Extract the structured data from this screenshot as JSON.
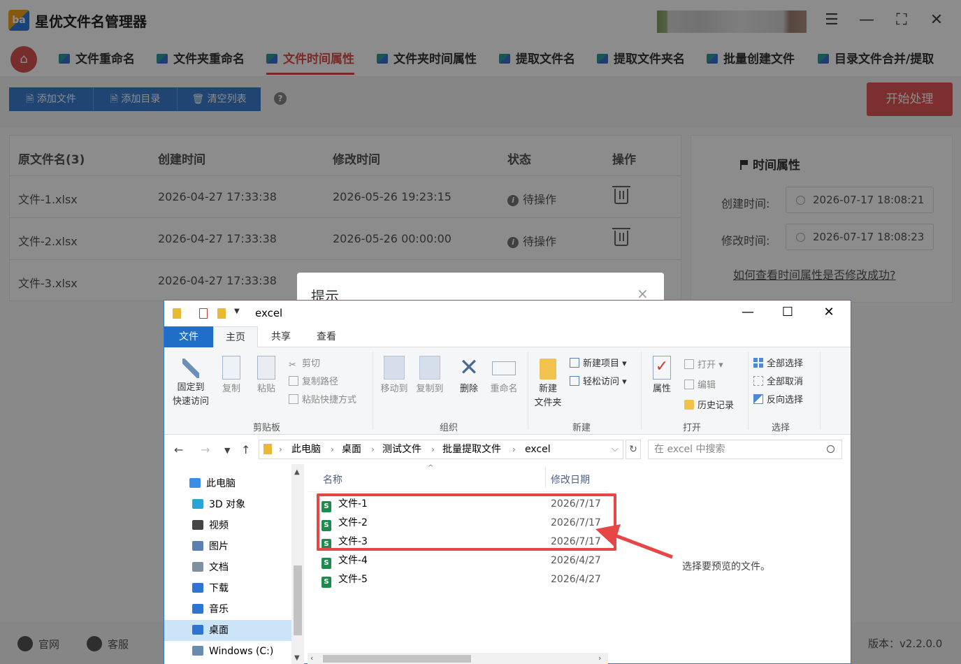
{
  "app": {
    "title": "星优文件名管理器",
    "logo_text": "ba"
  },
  "nav": {
    "items": [
      {
        "label": "文件重命名"
      },
      {
        "label": "文件夹重命名"
      },
      {
        "label": "文件时间属性"
      },
      {
        "label": "文件夹时间属性"
      },
      {
        "label": "提取文件名"
      },
      {
        "label": "提取文件夹名"
      },
      {
        "label": "批量创建文件"
      },
      {
        "label": "目录文件合并/提取"
      }
    ],
    "active_index": 2
  },
  "toolbar": {
    "add_file": "添加文件",
    "add_dir": "添加目录",
    "clear_list": "清空列表",
    "help": "?",
    "start": "开始处理"
  },
  "table": {
    "headers": [
      "原文件名(3)",
      "创建时间",
      "修改时间",
      "状态",
      "操作"
    ],
    "rows": [
      {
        "name": "文件-1.xlsx",
        "created": "2026-04-27 17:33:38",
        "modified": "2026-05-26 19:23:15",
        "status": "待操作"
      },
      {
        "name": "文件-2.xlsx",
        "created": "2026-04-27 17:33:38",
        "modified": "2026-05-26 00:00:00",
        "status": "待操作"
      },
      {
        "name": "文件-3.xlsx",
        "created": "2026-04-27 17:33:38",
        "modified": "",
        "status": ""
      }
    ]
  },
  "side": {
    "title": "时间属性",
    "created_label": "创建时间:",
    "created_value": "2026-07-17 18:08:21",
    "modified_label": "修改时间:",
    "modified_value": "2026-07-17 18:08:23",
    "link": "如何查看时间属性是否修改成功?"
  },
  "bottom": {
    "website": "官网",
    "support": "客服",
    "version": "版本：v2.2.0.0"
  },
  "hint_dialog": {
    "title": "提示",
    "close": "×"
  },
  "explorer": {
    "title": "excel",
    "tabs": [
      "文件",
      "主页",
      "共享",
      "查看"
    ],
    "active_tab": 1,
    "ribbon": {
      "pin": [
        "固定到",
        "快速访问"
      ],
      "copy": "复制",
      "paste": "粘贴",
      "cut": "剪切",
      "copy_path": "复制路径",
      "paste_shortcut": "粘贴快捷方式",
      "group_clipboard": "剪贴板",
      "move_to": "移动到",
      "copy_to": "复制到",
      "delete": "删除",
      "rename": "重命名",
      "group_organize": "组织",
      "new_folder": [
        "新建",
        "文件夹"
      ],
      "new_item": "新建项目",
      "easy_access": "轻松访问",
      "group_new": "新建",
      "properties": "属性",
      "open": "打开",
      "edit": "编辑",
      "history": "历史记录",
      "group_open": "打开",
      "select_all": "全部选择",
      "select_none": "全部取消",
      "invert": "反向选择",
      "group_select": "选择"
    },
    "breadcrumb": [
      "此电脑",
      "桌面",
      "测试文件",
      "批量提取文件",
      "excel"
    ],
    "search_placeholder": "在 excel 中搜索",
    "tree": [
      {
        "label": "此电脑",
        "color": "#3a8ee6"
      },
      {
        "label": "3D 对象",
        "color": "#2aa3d8"
      },
      {
        "label": "视频",
        "color": "#444444"
      },
      {
        "label": "图片",
        "color": "#5a7fb0"
      },
      {
        "label": "文档",
        "color": "#8090a0"
      },
      {
        "label": "下载",
        "color": "#2f74d0"
      },
      {
        "label": "音乐",
        "color": "#2f74d0"
      },
      {
        "label": "桌面",
        "color": "#2f74d0"
      },
      {
        "label": "Windows (C:)",
        "color": "#6a8bb0"
      }
    ],
    "tree_selected": 7,
    "columns": {
      "name": "名称",
      "modified": "修改日期"
    },
    "files": [
      {
        "name": "文件-1",
        "date": "2026/7/17"
      },
      {
        "name": "文件-2",
        "date": "2026/7/17"
      },
      {
        "name": "文件-3",
        "date": "2026/7/17"
      },
      {
        "name": "文件-4",
        "date": "2026/4/27"
      },
      {
        "name": "文件-5",
        "date": "2026/4/27"
      }
    ]
  },
  "annotation": {
    "text": "选择要预览的文件。",
    "color": "#e74646"
  }
}
